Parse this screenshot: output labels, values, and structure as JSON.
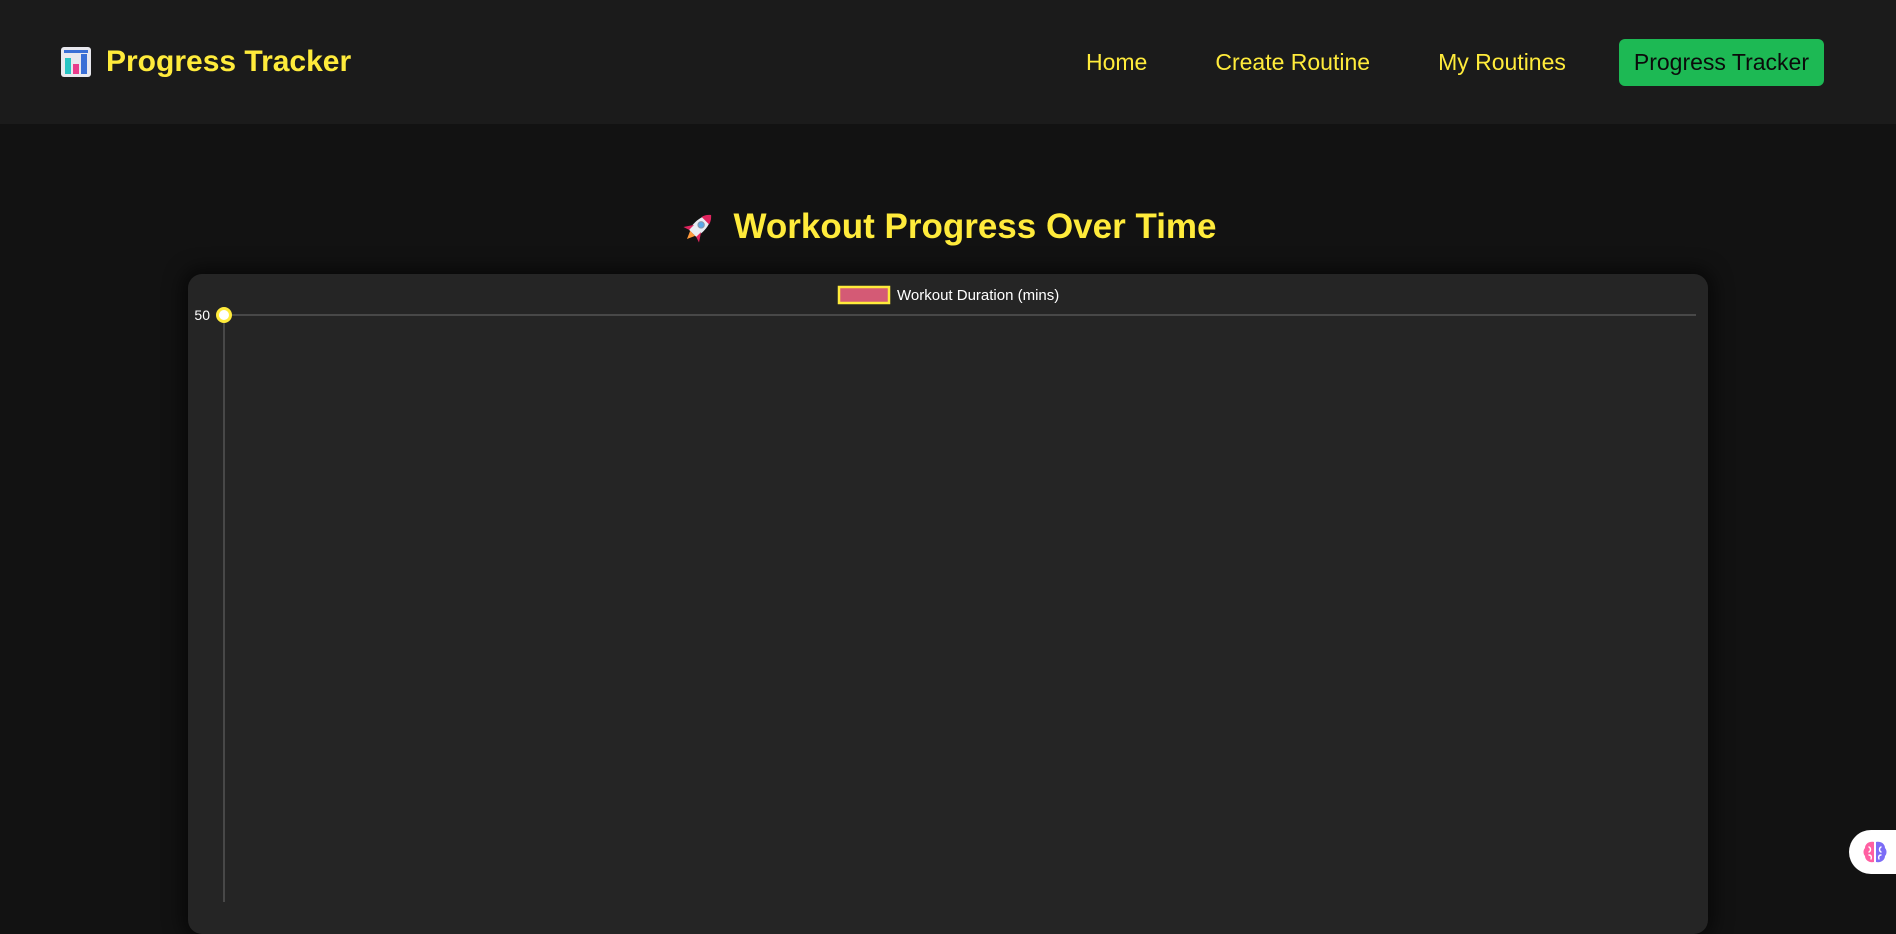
{
  "brand": {
    "title": "Progress Tracker",
    "icon": "bar-chart-icon"
  },
  "nav": {
    "items": [
      {
        "label": "Home",
        "active": false
      },
      {
        "label": "Create Routine",
        "active": false
      },
      {
        "label": "My Routines",
        "active": false
      },
      {
        "label": "Progress Tracker",
        "active": true
      }
    ]
  },
  "page": {
    "heading": "Workout Progress Over Time",
    "heading_icon": "rocket-icon"
  },
  "chart_data": {
    "type": "line",
    "legend": "Workout Duration (mins)",
    "legend_placement": "top-center",
    "series": [
      {
        "name": "Workout Duration (mins)",
        "values": [
          50
        ],
        "line_color": "#ffeb3b",
        "fill_color": "#d45a75",
        "point_color": "#ffffff"
      }
    ],
    "y_tick_labels": [
      "50"
    ],
    "ylim": [
      0,
      50
    ],
    "grid": true
  },
  "widget": {
    "icon": "brain-icon"
  },
  "colors": {
    "accent": "#ffeb3b",
    "active_nav": "#1db954",
    "background": "#121212",
    "navbar": "#1b1b1b",
    "card": "#252525"
  }
}
